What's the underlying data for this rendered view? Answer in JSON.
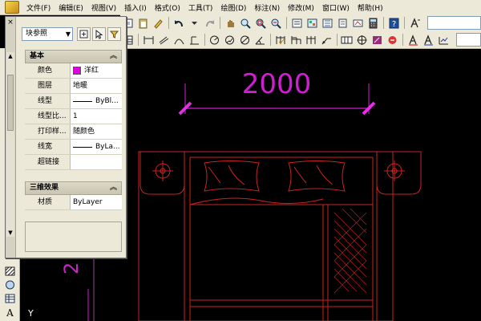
{
  "menu": {
    "items": [
      "文件(F)",
      "编辑(E)",
      "视图(V)",
      "插入(I)",
      "格式(O)",
      "工具(T)",
      "绘图(D)",
      "标注(N)",
      "修改(M)",
      "窗口(W)",
      "帮助(H)"
    ]
  },
  "palette": {
    "close_glyph": "×",
    "selector_value": "块参照",
    "sections": {
      "basic": {
        "title": "基本",
        "rows": [
          {
            "label": "颜色",
            "value": "洋红"
          },
          {
            "label": "图层",
            "value": "地暖"
          },
          {
            "label": "线型",
            "value": "ByBl..."
          },
          {
            "label": "线型比...",
            "value": "1"
          },
          {
            "label": "打印样...",
            "value": "随颜色"
          },
          {
            "label": "线宽",
            "value": "ByLa..."
          },
          {
            "label": "超链接",
            "value": ""
          }
        ]
      },
      "effects3d": {
        "title": "三维效果",
        "rows": [
          {
            "label": "材质",
            "value": "ByLayer"
          }
        ]
      }
    }
  },
  "drawing": {
    "dimension_text": "2000",
    "side_text": "2",
    "axis_label": "Y"
  },
  "colors": {
    "canvas": "#000000",
    "bed_lines": "#cc2222",
    "dimension": "#d21ed2",
    "ui_face": "#ece9d8"
  }
}
